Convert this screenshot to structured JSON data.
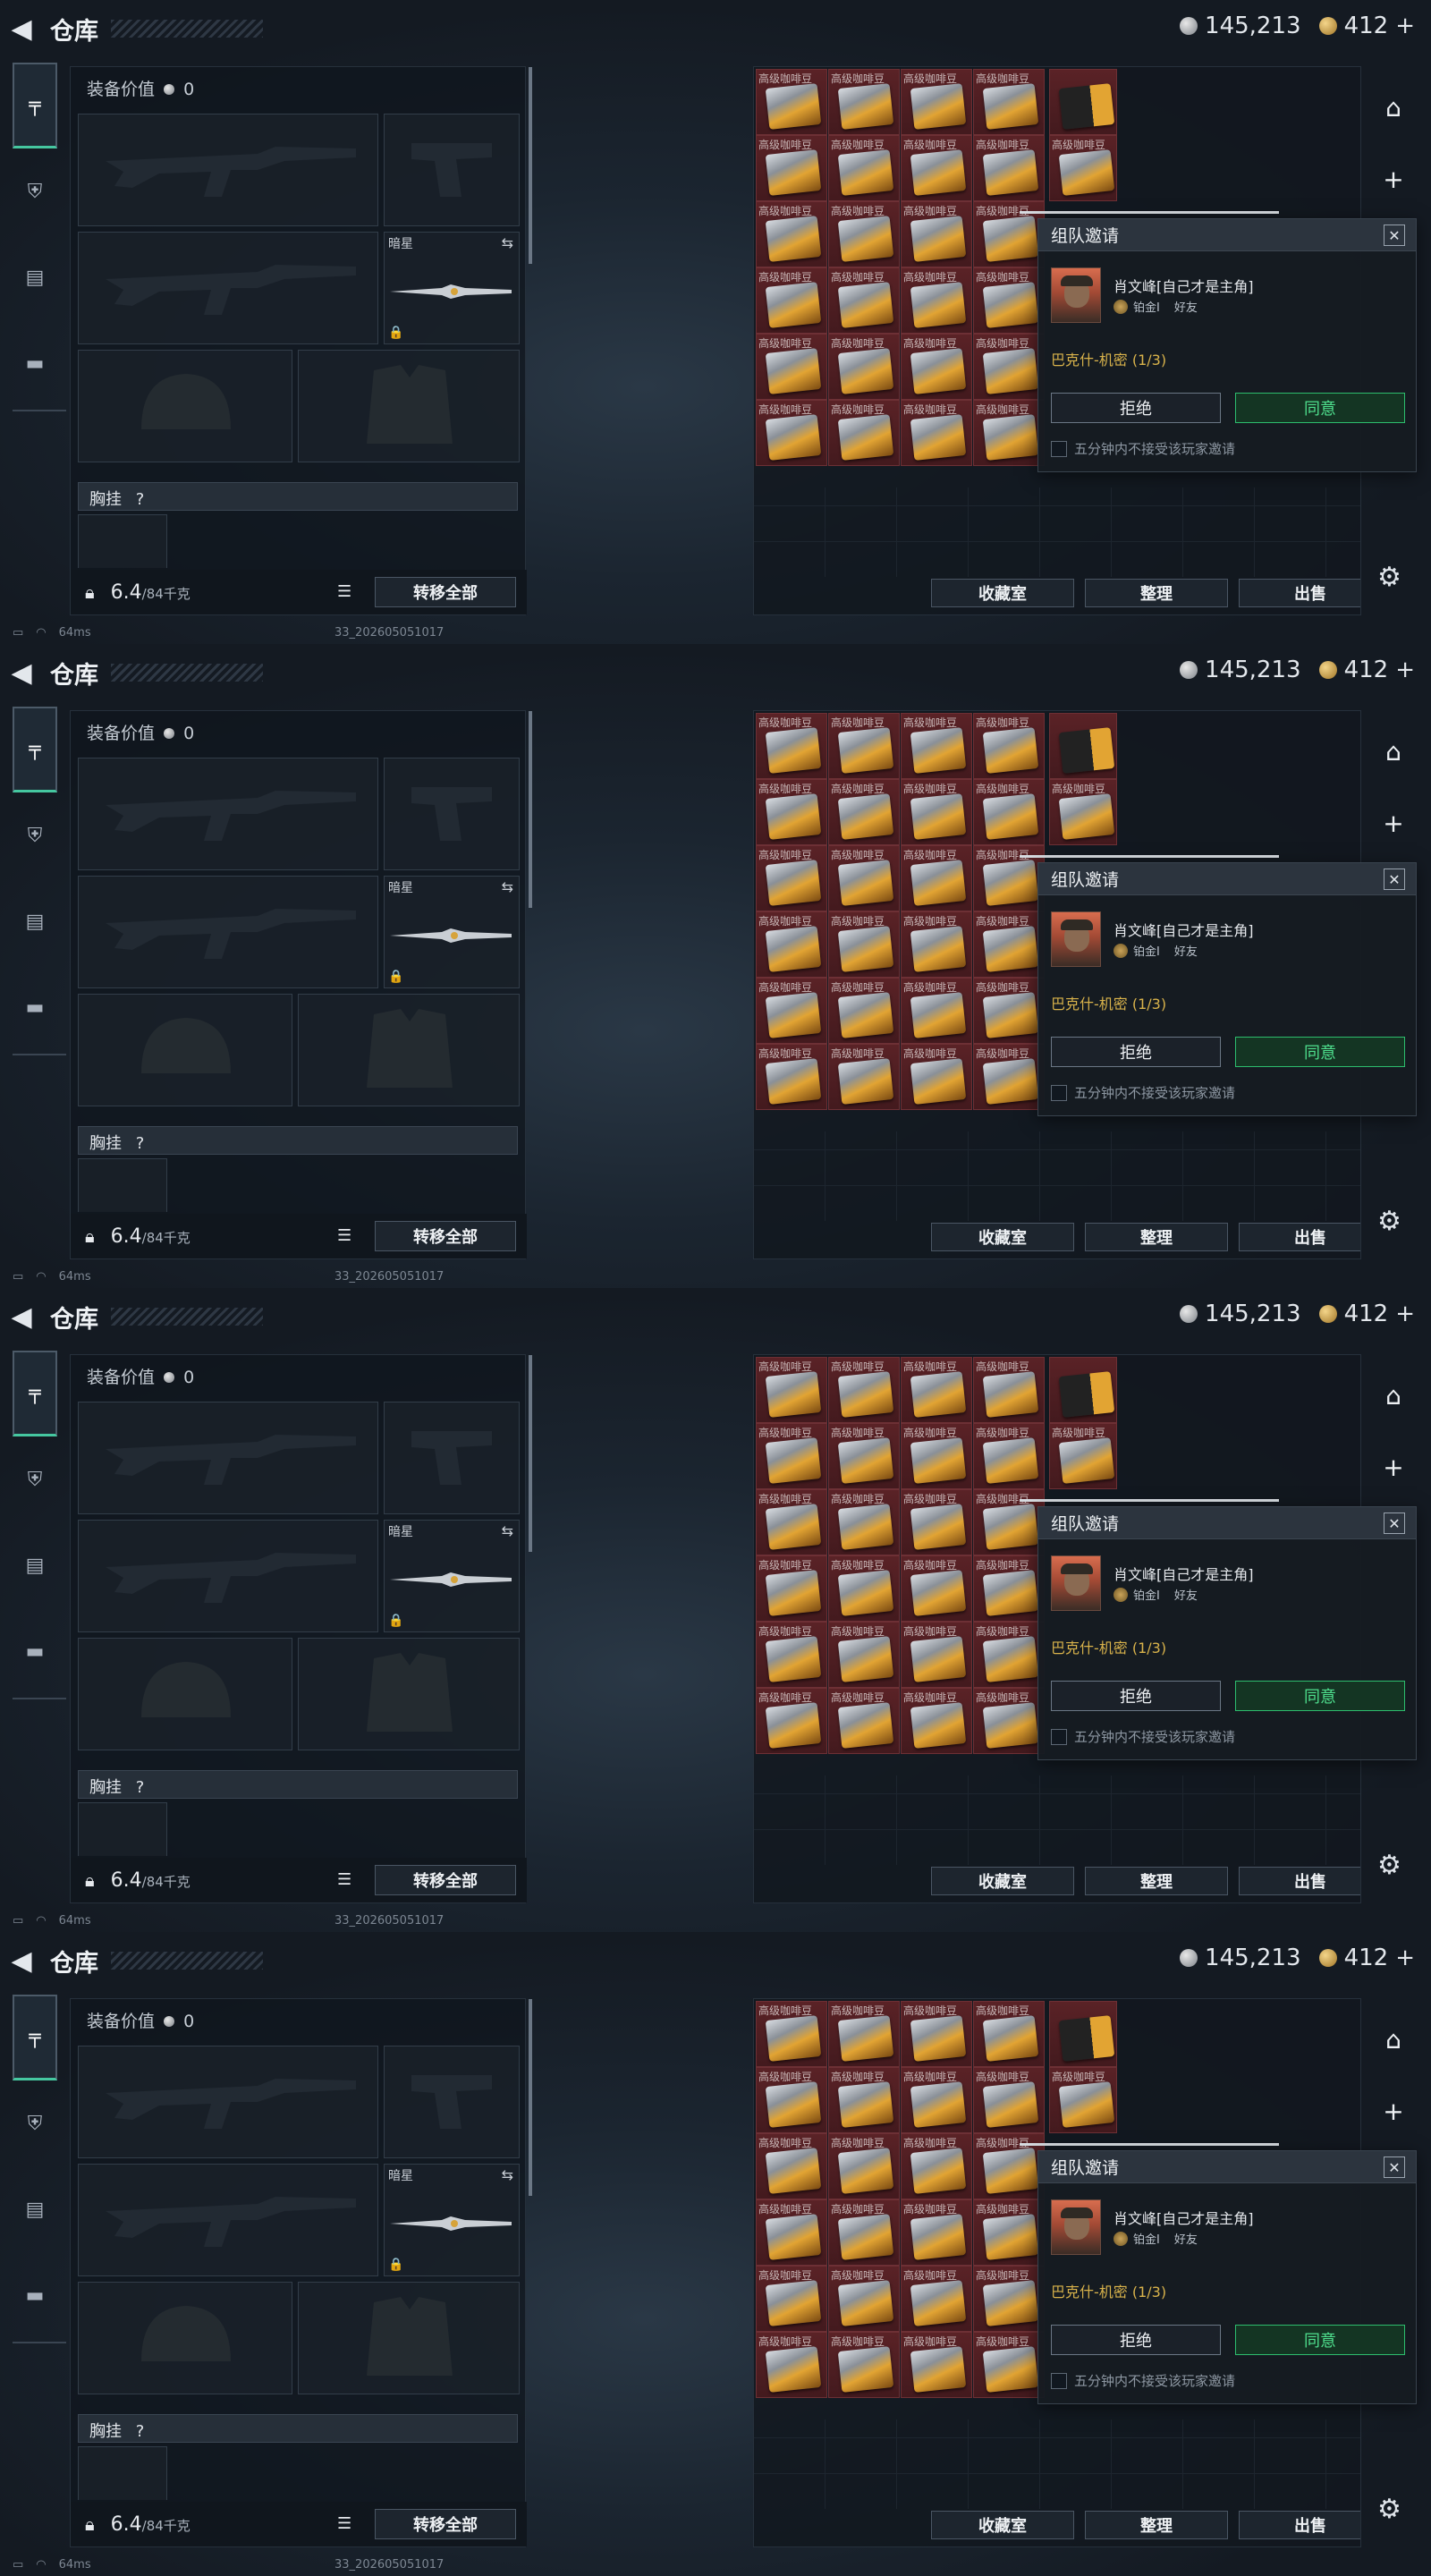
{
  "header": {
    "title": "仓库",
    "currency_silver": "145,213",
    "currency_gold": "412",
    "gold_plus": "+"
  },
  "equipment": {
    "value_label": "装备价值",
    "value": "0",
    "secondary_name": "暗星",
    "chest_label": "胸挂",
    "chest_help": "?",
    "weight_current": "6.4",
    "weight_max": "/84千克",
    "transfer_all": "转移全部"
  },
  "stash": {
    "item_label": "高级咖啡豆",
    "buttons": [
      "收藏室",
      "整理",
      "出售"
    ]
  },
  "dialog": {
    "title": "组队邀请",
    "player_name": "肖文峰[自己才是主角]",
    "rank": "铂金Ⅰ",
    "relation": "好友",
    "map": "巴克什-机密 (1/3)",
    "reject": "拒绝",
    "accept": "同意",
    "mute_option": "五分钟内不接受该玩家邀请"
  },
  "status": {
    "ping": "64ms",
    "build": "33_202605051017"
  },
  "colors": {
    "accent_green": "#2dbd6e",
    "map_gold": "#d9b34b",
    "stash_red": "#5a2226"
  }
}
